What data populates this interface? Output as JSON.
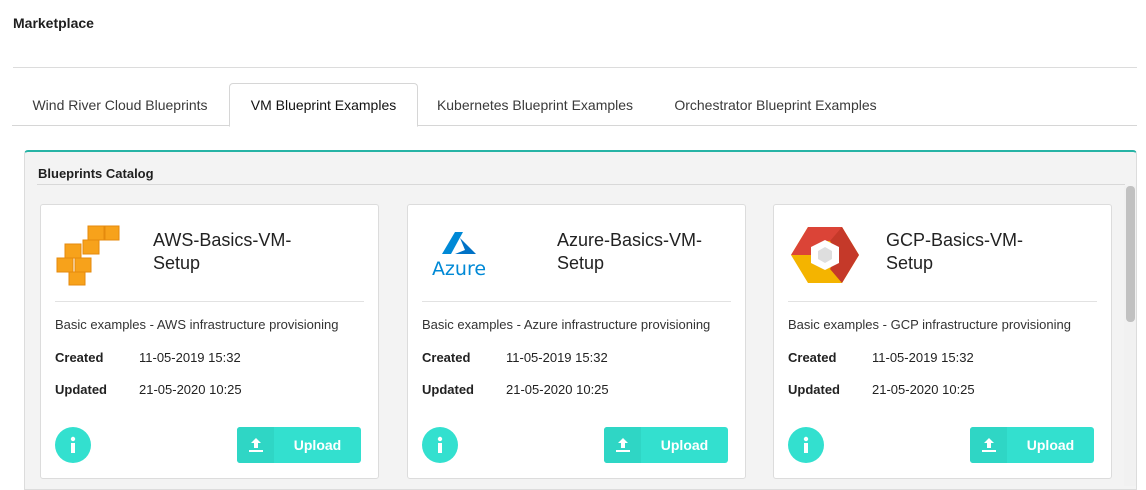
{
  "page": {
    "title": "Marketplace"
  },
  "tabs": [
    {
      "label": "Wind River Cloud Blueprints",
      "active": false
    },
    {
      "label": "VM Blueprint Examples",
      "active": true
    },
    {
      "label": "Kubernetes Blueprint Examples",
      "active": false
    },
    {
      "label": "Orchestrator Blueprint Examples",
      "active": false
    }
  ],
  "catalog": {
    "title": "Blueprints Catalog",
    "cards": [
      {
        "name": "AWS-Basics-VM-Setup",
        "logo": "aws-logo",
        "description": "Basic examples - AWS infrastructure provisioning",
        "created_label": "Created",
        "created": "11-05-2019 15:32",
        "updated_label": "Updated",
        "updated": "21-05-2020 10:25",
        "upload_label": "Upload"
      },
      {
        "name": "Azure-Basics-VM-Setup",
        "logo": "azure-logo",
        "logo_text": "Azure",
        "description": "Basic examples - Azure infrastructure provisioning",
        "created_label": "Created",
        "created": "11-05-2019 15:32",
        "updated_label": "Updated",
        "updated": "21-05-2020 10:25",
        "upload_label": "Upload"
      },
      {
        "name": "GCP-Basics-VM-Setup",
        "logo": "gcp-logo",
        "description": "Basic examples - GCP infrastructure provisioning",
        "created_label": "Created",
        "created": "11-05-2019 15:32",
        "updated_label": "Updated",
        "updated": "21-05-2020 10:25",
        "upload_label": "Upload"
      }
    ]
  },
  "colors": {
    "accent": "#33e0cf",
    "catalog_border": "#26b3a5",
    "aws_orange": "#f7a21b",
    "azure_blue": "#0089d6",
    "gcp_red": "#db4437",
    "gcp_yellow": "#f4b400",
    "gcp_blue": "#4285f4"
  }
}
